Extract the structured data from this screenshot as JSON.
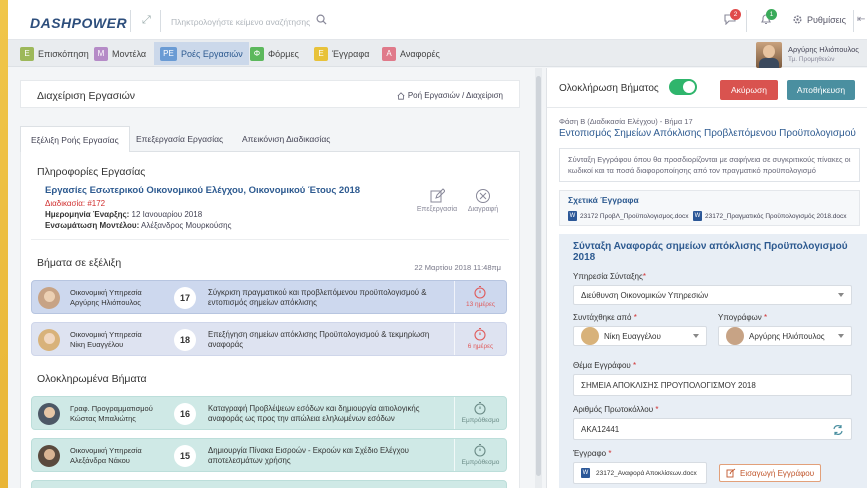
{
  "app": {
    "logo": "DASHPOWER"
  },
  "topbar": {
    "search_placeholder": "Πληκτρολογήστε κείμενο αναζήτησης",
    "chat_badge": "2",
    "bell_badge": "1",
    "settings_label": "Ρυθμίσεις"
  },
  "menu": {
    "items": [
      {
        "letter": "Ε",
        "label": "Επισκόπηση",
        "color": "#9db85a"
      },
      {
        "letter": "Μ",
        "label": "Μοντέλα",
        "color": "#b58bc7"
      },
      {
        "letter": "ΡΕ",
        "label": "Ροές Εργασιών",
        "color": "#6a9bd4"
      },
      {
        "letter": "Φ",
        "label": "Φόρμες",
        "color": "#5cb85c"
      },
      {
        "letter": "Ε",
        "label": "Έγγραφα",
        "color": "#e8c23a"
      },
      {
        "letter": "Α",
        "label": "Αναφορές",
        "color": "#e07a8a"
      }
    ],
    "user_name": "Αργύρης Ηλιόπουλος",
    "user_dept": "Τμ. Προμηθειών"
  },
  "left": {
    "title": "Διαχείριση Εργασιών",
    "breadcrumb": "Ροή Εργασιών / Διαχείριση",
    "tabs": [
      "Εξέλιξη Ροής Εργασίας",
      "Επεξεργασία Εργασίας",
      "Απεικόνιση Διαδικασίας"
    ],
    "info_heading": "Πληροφορίες Εργασίας",
    "task_title": "Εργασίες Εσωτερικού Οικονομικού Ελέγχου, Οικονομικού Έτους 2018",
    "process_label": "Διαδικασία:",
    "process_value": "#172",
    "start_label": "Ημερομηνία Έναρξης:",
    "start_value": "12 Ιανουαρίου 2018",
    "model_label": "Ενσωμάτωση Μοντέλου:",
    "model_value": "Αλέξανδρος Μουρκούσης",
    "edit_label": "Επεξεργασία",
    "delete_label": "Διαγραφή",
    "progress_heading": "Βήματα σε εξέλιξη",
    "progress_date": "22 Μαρτίου 2018  11:48πμ",
    "in_progress": [
      {
        "dept": "Οικονομική Υπηρεσία",
        "person": "Αργύρης Ηλιόπουλος",
        "num": "17",
        "desc": "Σύγκριση πραγματικού και προβλεπόμενου προϋπολογισμού & εντοπισμός σημείων απόκλισης",
        "status": "13 ημέρες"
      },
      {
        "dept": "Οικονομική Υπηρεσία",
        "person": "Νίκη Ευαγγέλου",
        "num": "18",
        "desc": "Επεξήγηση σημείων απόκλισης Προϋπολογισμού & τεκμηρίωση αναφοράς",
        "status": "6 ημέρες"
      }
    ],
    "done_heading": "Ολοκληρωμένα Βήματα",
    "completed": [
      {
        "dept": "Γραφ. Προγραμματισμού",
        "person": "Κώστας Μπαλιώτης",
        "num": "16",
        "desc": "Καταγραφή Προβλέψεων εσόδων και δημιουργία αιτιολογικής αναφοράς ως προς την απώλεια εληλωμένων εσόδων",
        "status": "Εμπρόθεσμο"
      },
      {
        "dept": "Οικονομική Υπηρεσία",
        "person": "Αλεξάνδρα Νάκου",
        "num": "15",
        "desc": "Δημιουργία Πίνακα Εισροών - Εκροών και Σχέδιο Ελέγχου αποτελεσμάτων χρήσης",
        "status": "Εμπρόθεσμο"
      }
    ]
  },
  "right": {
    "completion_label": "Ολοκλήρωση Βήματος",
    "cancel_label": "Ακύρωση",
    "save_label": "Αποθήκευση",
    "phase": "Φάση Β (Διαδικασία Ελέγχου) - Βήμα 17",
    "step_title": "Εντοπισμός Σημείων Απόκλισης  Προβλεπόμενου Προϋπολογισμού",
    "description": "Σύνταξη Εγγράφου όπου θα προσδιορίζονται με σαφήνεια σε συγκριτικούς πίνακες οι κωδικοί και τα ποσά  διαφοροποίησης από τον πραγματικό προϋπολογισμό",
    "related_heading": "Σχετικά Έγγραφα",
    "related_files": [
      "23172 ΠροβΛ_Προϋπολογισμος.docx",
      "23172_Πραγματικός Προϋπολογισμός 2018.docx"
    ],
    "form_heading": "Σύνταξη Αναφοράς σημείων απόκλισης Προϋπολογισμού 2018",
    "service_label": "Υπηρεσία Σύνταξης",
    "service_value": "Διεύθυνση Οικονομικών Υπηρεσιών",
    "author_label": "Συντάχθηκε από",
    "author_value": "Νίκη Ευαγγέλου",
    "signer_label": "Υπογράφων",
    "signer_value": "Αργύρης Ηλιόπουλος",
    "subject_label": "Θέμα Εγγράφου",
    "subject_value": "ΣΗΜΕΙΑ ΑΠΟΚΛΙΣΗΣ ΠΡΟΥΠΟΛΟΓΙΣΜΟΥ 2018",
    "protocol_label": "Αριθμός Πρωτοκόλλου",
    "protocol_value": "ΑΚΑ12441",
    "doc_label": "Έγγραφο",
    "doc_file": "23172_Αναφορά Αποκλίσεων.docx",
    "import_label": "Εισαγωγή Εγγράφου"
  },
  "colors": {
    "accent": "#2d5a90",
    "danger": "#d9534f",
    "primary": "#4a8fa0",
    "toggle": "#2fb56c"
  }
}
